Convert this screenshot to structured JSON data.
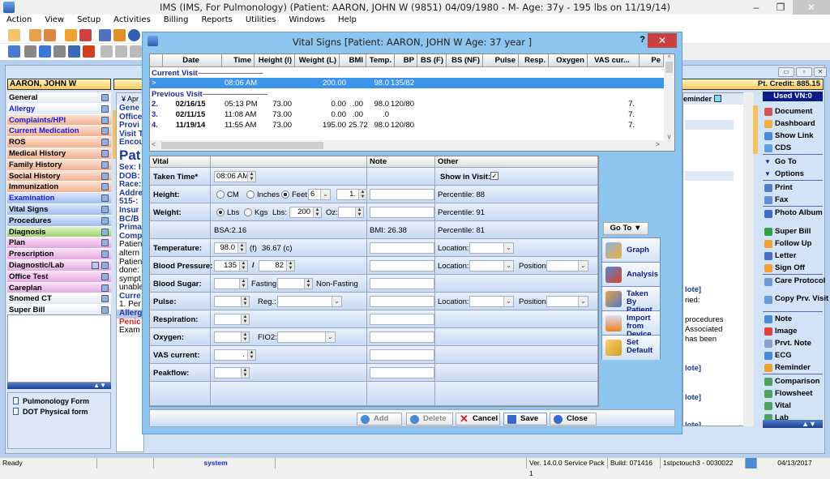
{
  "window": {
    "title": "IMS (IMS, For Pulmonology)     (Patient: AARON, JOHN W (9851) 04/09/1980 - M- Age: 37y  - 195 lbs on 11/19/14)",
    "minimize": "–",
    "restore": "❐",
    "close": "✕"
  },
  "menu": [
    "Action",
    "View",
    "Setup",
    "Activities",
    "Billing",
    "Reports",
    "Utilities",
    "Windows",
    "Help"
  ],
  "patient": {
    "name": "AARON, JOHN W",
    "credit": "Pt. Credit: 885.15",
    "used_vn": "Used VN:0"
  },
  "left_nav": [
    {
      "label": "General",
      "color": "white",
      "blue": false
    },
    {
      "label": "Allergy",
      "color": "white",
      "blue": true
    },
    {
      "label": "Complaints/HPI",
      "color": "orange",
      "blue": true
    },
    {
      "label": "Current Medication",
      "color": "orange",
      "blue": true
    },
    {
      "label": "ROS",
      "color": "orange",
      "blue": false
    },
    {
      "label": "Medical History",
      "color": "orange",
      "blue": false
    },
    {
      "label": "Family History",
      "color": "orange",
      "blue": false
    },
    {
      "label": "Social History",
      "color": "orange",
      "blue": false
    },
    {
      "label": "Immunization",
      "color": "orange",
      "blue": false
    },
    {
      "label": "Examination",
      "color": "blue",
      "blue": true
    },
    {
      "label": "Vital Signs",
      "color": "blue",
      "blue": false
    },
    {
      "label": "Procedures",
      "color": "blue",
      "blue": false
    },
    {
      "label": "Diagnosis",
      "color": "green",
      "blue": false
    },
    {
      "label": "Plan",
      "color": "pink",
      "blue": false
    },
    {
      "label": "Prescription",
      "color": "pink",
      "blue": false
    },
    {
      "label": "Diagnostic/Lab",
      "color": "pink",
      "blue": false
    },
    {
      "label": "Office Test",
      "color": "pink",
      "blue": false
    },
    {
      "label": "Careplan",
      "color": "pink",
      "blue": false
    },
    {
      "label": "Snomed CT",
      "color": "white",
      "blue": false
    },
    {
      "label": "Super Bill",
      "color": "white",
      "blue": false
    }
  ],
  "forms": [
    "Pulmonology Form",
    "DOT Physical form"
  ],
  "left_doc": {
    "header": "Apr",
    "lines": [
      "Gene",
      "Office",
      "Provi",
      "",
      "Visit T",
      "Encou",
      "",
      "Pat",
      "Sex: I",
      "DOB:",
      "Race:",
      "Addre",
      "515-:",
      "Insur",
      "BC/B",
      "Prima",
      "",
      "Comp",
      "Patien",
      "altern",
      "Patien",
      "done:",
      "sympt",
      "unable",
      "",
      "Curre",
      "1. Per",
      "",
      "Allerg",
      "Penic",
      "",
      "Exam"
    ]
  },
  "right_doc": {
    "reminder_label": "eminder",
    "lines": [
      "lote]",
      "ried:",
      "",
      "procedures",
      "Associated",
      "has been",
      "",
      "lote]",
      "lote]",
      "lote]"
    ]
  },
  "right_tools": [
    {
      "label": "Document",
      "group": 1
    },
    {
      "label": "Dashboard",
      "group": 1
    },
    {
      "label": "Show Link",
      "group": 1
    },
    {
      "label": "CDS",
      "group": 1
    },
    {
      "label": "Go To",
      "group": 2
    },
    {
      "label": "Options",
      "group": 2
    },
    {
      "label": "Print",
      "group": 3
    },
    {
      "label": "Fax",
      "group": 3
    },
    {
      "label": "Photo Album",
      "group": 4
    },
    {
      "label": "Super Bill",
      "group": 4
    },
    {
      "label": "Follow Up",
      "group": 4
    },
    {
      "label": "Letter",
      "group": 4
    },
    {
      "label": "Sign Off",
      "group": 4
    },
    {
      "label": "Care Protocol",
      "group": 5
    },
    {
      "label": "Copy Prv. Visit",
      "group": 5
    },
    {
      "label": "Note",
      "group": 6
    },
    {
      "label": "Image",
      "group": 6
    },
    {
      "label": "Prvt. Note",
      "group": 6
    },
    {
      "label": "ECG",
      "group": 6
    },
    {
      "label": "Reminder",
      "group": 6
    },
    {
      "label": "Comparison",
      "group": 7
    },
    {
      "label": "Flowsheet",
      "group": 7
    },
    {
      "label": "Vital",
      "group": 7
    },
    {
      "label": "Lab",
      "group": 7
    }
  ],
  "status": {
    "ready": "Ready",
    "user": "system",
    "version": "Ver. 14.0.0 Service Pack 1",
    "build": "Build: 071416",
    "station": "1stpctouch3 - 0030022",
    "date": "04/13/2017"
  },
  "dialog": {
    "title": "Vital Signs  [Patient: AARON, JOHN W  Age: 37 year ]",
    "help": "?",
    "close": "✕",
    "grid": {
      "columns": [
        "",
        "Date",
        "Time",
        "Height (I)",
        "Weight (L)",
        "BMI",
        "Temp.",
        "BP",
        "BS (F)",
        "BS (NF)",
        "Pulse",
        "Resp.",
        "Oxygen",
        "VAS cur...",
        "Pe"
      ],
      "current_label": "Current Visit",
      "previous_label": "Previous Visit",
      "current": {
        "idx": ">",
        "date": "",
        "time": "08:06 AM",
        "height": "",
        "weight": "200.00",
        "bmi": "",
        "temp": "98.0",
        "bp": "135/82",
        "vas": ""
      },
      "previous": [
        {
          "idx": "2.",
          "date": "02/16/15",
          "time": "05:13 PM",
          "height": "73.00",
          "weight": "0.00",
          "bmi": ".00",
          "temp": "98.0",
          "bp": "120/80",
          "vas": "7."
        },
        {
          "idx": "3.",
          "date": "02/11/15",
          "time": "11:08 AM",
          "height": "73.00",
          "weight": "0.00",
          "bmi": ".00",
          "temp": ".0",
          "bp": "",
          "vas": "7."
        },
        {
          "idx": "4.",
          "date": "11/19/14",
          "time": "11:55 AM",
          "height": "73.00",
          "weight": "195.00",
          "bmi": "25.72",
          "temp": "98.0",
          "bp": "120/80",
          "vas": "7."
        }
      ]
    },
    "form": {
      "headers": {
        "vital": "Vital",
        "note": "Note",
        "other": "Other"
      },
      "taken_time": {
        "label": "Taken Time*",
        "value": "08:06 AM"
      },
      "show_in_visit": {
        "label": "Show in Visit:",
        "checked": true
      },
      "height": {
        "label": "Height:",
        "units": [
          "CM",
          "Inches",
          "Feet"
        ],
        "selected": "Feet",
        "feet": "6",
        "inches": "1.",
        "percentile": "Percentile: 88"
      },
      "weight": {
        "label": "Weight:",
        "units": [
          "Lbs",
          "Kgs"
        ],
        "selected": "Lbs",
        "lbs_label": "Lbs:",
        "lbs": "200",
        "oz_label": "Oz:",
        "oz": "",
        "percentile": "Percentile: 91"
      },
      "bsa": {
        "text": "BSA:2.16",
        "bmi": "BMI: 26.38",
        "percentile": "Percentile: 81"
      },
      "temperature": {
        "label": "Temperature:",
        "value": "98.0",
        "f": "(f)",
        "c": "36.67 (c)",
        "location_label": "Location:"
      },
      "blood_pressure": {
        "label": "Blood Pressure:",
        "sys": "135",
        "sep": "/",
        "dia": "82",
        "location_label": "Location:",
        "position_label": "Position:"
      },
      "blood_sugar": {
        "label": "Blood Sugar:",
        "fasting_label": "Fasting",
        "nonfasting_label": "Non-Fasting"
      },
      "pulse": {
        "label": "Pulse:",
        "reg_label": "Reg.:",
        "location_label": "Location:",
        "position_label": "Position:"
      },
      "respiration": {
        "label": "Respiration:"
      },
      "oxygen": {
        "label": "Oxygen:",
        "fio2_label": "FIO2:"
      },
      "vas": {
        "label": "VAS current:",
        "value": "."
      },
      "peakflow": {
        "label": "Peakflow:"
      }
    },
    "goto": "Go To  ▼",
    "side_buttons": [
      "Graph",
      "Analysis",
      "Taken By Patient",
      "Import from Device",
      "Set Default"
    ],
    "buttons": {
      "add": "Add",
      "delete": "Delete",
      "cancel": "Cancel",
      "save": "Save",
      "close": "Close"
    }
  }
}
